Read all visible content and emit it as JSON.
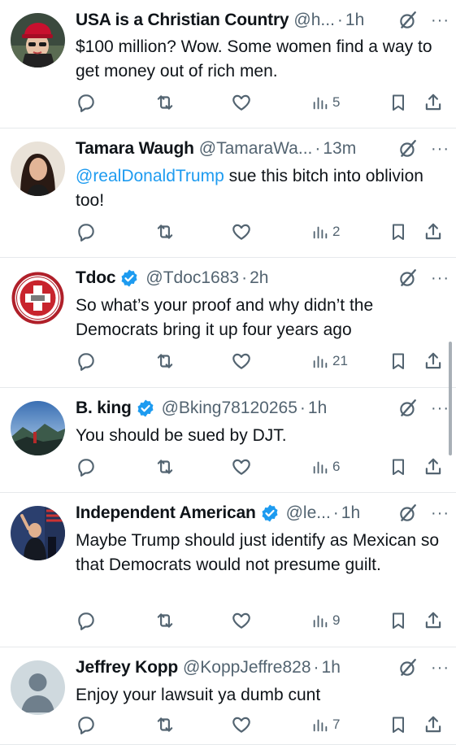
{
  "tweets": [
    {
      "name": "USA is a Christian Country",
      "handle": "@h...",
      "time": "1h",
      "verified": false,
      "text_segments": [
        {
          "t": "$100 million? Wow. Some women find a way to get money out of rich men.",
          "mention": false
        }
      ],
      "views": "5",
      "avatar": "red-cap-woman"
    },
    {
      "name": "Tamara Waugh",
      "handle": "@TamaraWa...",
      "time": "13m",
      "verified": false,
      "text_segments": [
        {
          "t": "@realDonaldTrump",
          "mention": true
        },
        {
          "t": " sue this bitch into oblivion too!",
          "mention": false
        }
      ],
      "views": "2",
      "avatar": "dark-hair-woman"
    },
    {
      "name": "Tdoc",
      "handle": "@Tdoc1683",
      "time": "2h",
      "verified": true,
      "text_segments": [
        {
          "t": "So what’s your proof and why didn’t the Democrats bring it up four years ago",
          "mention": false
        }
      ],
      "views": "21",
      "avatar": "combat-medic-badge"
    },
    {
      "name": "B. king",
      "handle": "@Bking78120265",
      "time": "1h",
      "verified": true,
      "text_segments": [
        {
          "t": "You should be sued by DJT.",
          "mention": false
        }
      ],
      "views": "6",
      "avatar": "mountain-landscape"
    },
    {
      "name": "Independent American",
      "handle": "@le...",
      "time": "1h",
      "verified": true,
      "text_segments": [
        {
          "t": "Maybe Trump should just identify as Mexican so that Democrats would not presume guilt.",
          "mention": false
        }
      ],
      "views": "9",
      "avatar": "rally-photo"
    },
    {
      "name": "Jeffrey Kopp",
      "handle": "@KoppJeffre828",
      "time": "1h",
      "verified": false,
      "text_segments": [
        {
          "t": "Enjoy your lawsuit ya dumb cunt",
          "mention": false
        }
      ],
      "views": "7",
      "avatar": "default-avatar"
    }
  ],
  "icons": {
    "reply": "reply-icon",
    "repost": "repost-icon",
    "like": "like-icon",
    "views": "views-icon",
    "bookmark": "bookmark-icon",
    "share": "share-icon",
    "grok": "grok-icon",
    "more": "more-icon",
    "verified": "verified-badge-icon"
  },
  "ui": {
    "more_glyph": "···"
  },
  "colors": {
    "text": "#0f1419",
    "secondary": "#536471",
    "mention": "#1d9bf0",
    "verified": "#1d9bf0",
    "divider": "#e6e9ec"
  }
}
